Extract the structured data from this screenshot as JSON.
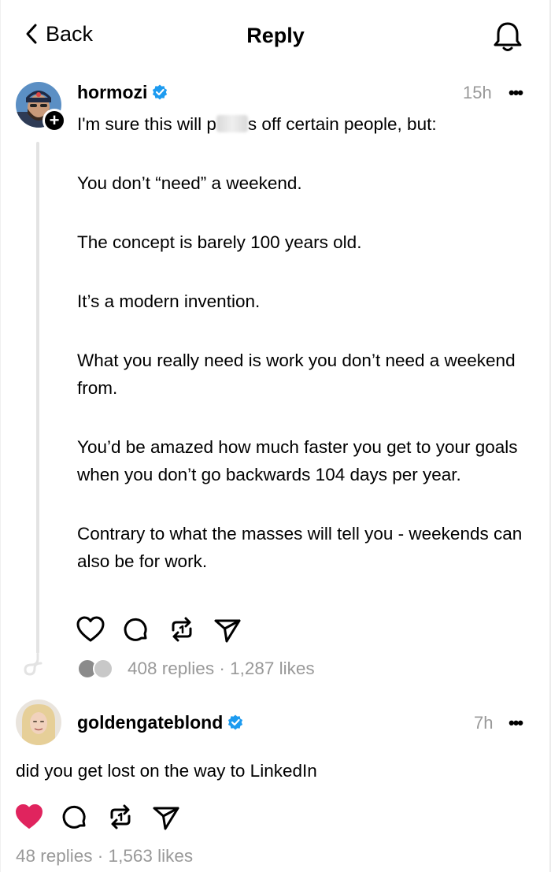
{
  "header": {
    "back_label": "Back",
    "title": "Reply",
    "icons": {
      "back": "chevron-left-icon",
      "notifications": "bell-icon"
    }
  },
  "post": {
    "author": "hormozi",
    "verified": true,
    "time": "15h",
    "more": "•••",
    "line1_before": "I'm sure this will p",
    "line1_after": "s off certain people, but:",
    "paragraphs": [
      "You don’t “need” a weekend.",
      "The concept is barely 100 years old.",
      "It’s a modern invention.",
      "What you really need is work you don’t need a weekend from.",
      "You’d be amazed how much faster you get to your goals when you don’t go backwards 104 days per year.",
      "Contrary to what the masses will tell you - weekends can also be for work."
    ],
    "stats": "408 replies · 1,287 likes",
    "liked": false,
    "follow_badge": "+"
  },
  "reply": {
    "author": "goldengateblond",
    "verified": true,
    "time": "7h",
    "more": "•••",
    "text": "did you get lost on the way to LinkedIn",
    "stats": "48 replies · 1,563 likes",
    "liked": true
  },
  "colors": {
    "verified": "#1d9bf0",
    "liked_heart": "#e0245e",
    "muted_text": "#999999",
    "thread_line": "#e3e3e3"
  }
}
